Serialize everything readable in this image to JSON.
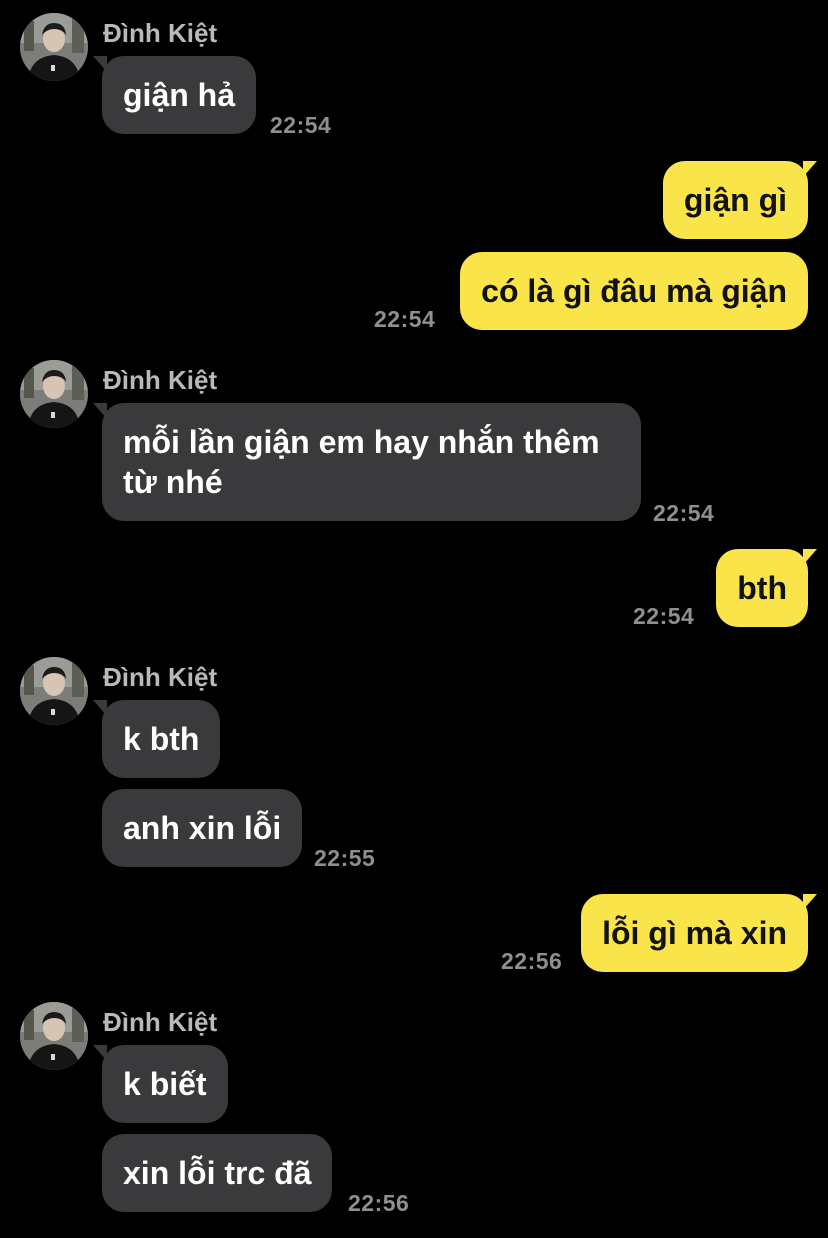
{
  "sender_name": "Đình Kiệt",
  "icons": {
    "avatar": "profile-photo-icon"
  },
  "colors": {
    "background": "#000000",
    "incoming_bubble": "#3a3a3c",
    "outgoing_bubble": "#f9e44a",
    "timestamp": "#8e8e93"
  },
  "messages": [
    {
      "text": "giận hả"
    },
    {
      "text": "giận gì"
    },
    {
      "text": "có là gì đâu mà giận"
    },
    {
      "text": "mỗi lần giận em hay nhắn thêm từ nhé"
    },
    {
      "text": "bth"
    },
    {
      "text": "k bth"
    },
    {
      "text": "anh xin lỗi"
    },
    {
      "text": "lỗi gì mà xin"
    },
    {
      "text": "k biết"
    },
    {
      "text": "xin lỗi trc đã"
    }
  ],
  "timestamps": [
    "22:54",
    "22:54",
    "22:54",
    "22:54",
    "22:55",
    "22:56",
    "22:56"
  ]
}
